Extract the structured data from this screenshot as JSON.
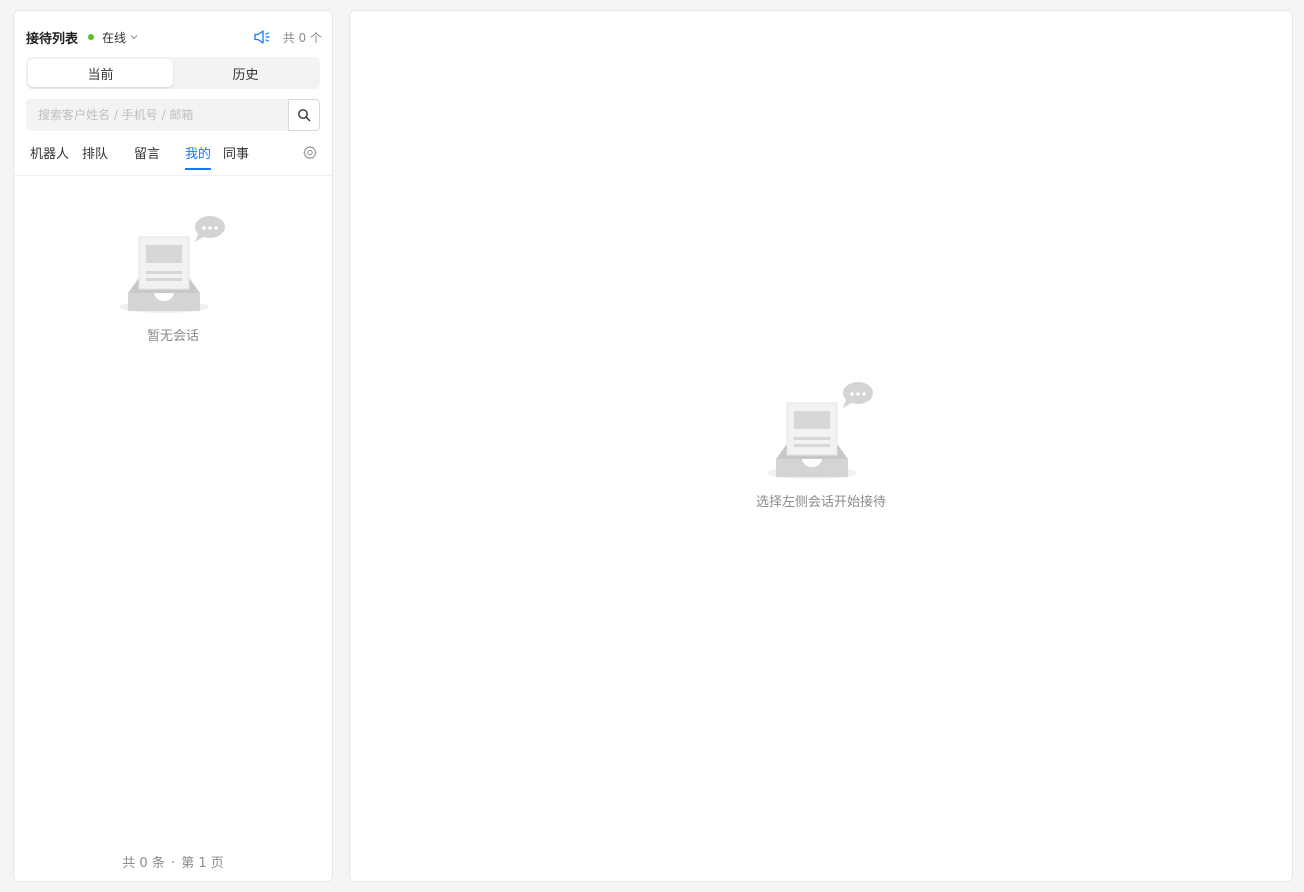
{
  "sidebar": {
    "title": "接待列表",
    "status": {
      "label": "在线",
      "color": "#52c41a"
    },
    "count_text": "共 0 个",
    "segments": [
      {
        "label": "当前",
        "active": true
      },
      {
        "label": "历史",
        "active": false
      }
    ],
    "search": {
      "placeholder": "搜索客户姓名 / 手机号 / 邮箱",
      "value": ""
    },
    "filters": [
      {
        "label": "机器人",
        "active": false
      },
      {
        "label": "排队",
        "active": false
      },
      {
        "label": "留言",
        "active": false
      },
      {
        "label": "我的",
        "active": true
      },
      {
        "label": "同事",
        "active": false
      }
    ],
    "empty_text": "暂无会话",
    "footer": {
      "total": "共 0 条",
      "separator": "·",
      "page": "第 1 页"
    }
  },
  "main": {
    "empty_text": "选择左侧会话开始接待"
  },
  "colors": {
    "accent": "#1677ff",
    "online": "#52c41a",
    "muted_text": "#8c8c8c"
  }
}
